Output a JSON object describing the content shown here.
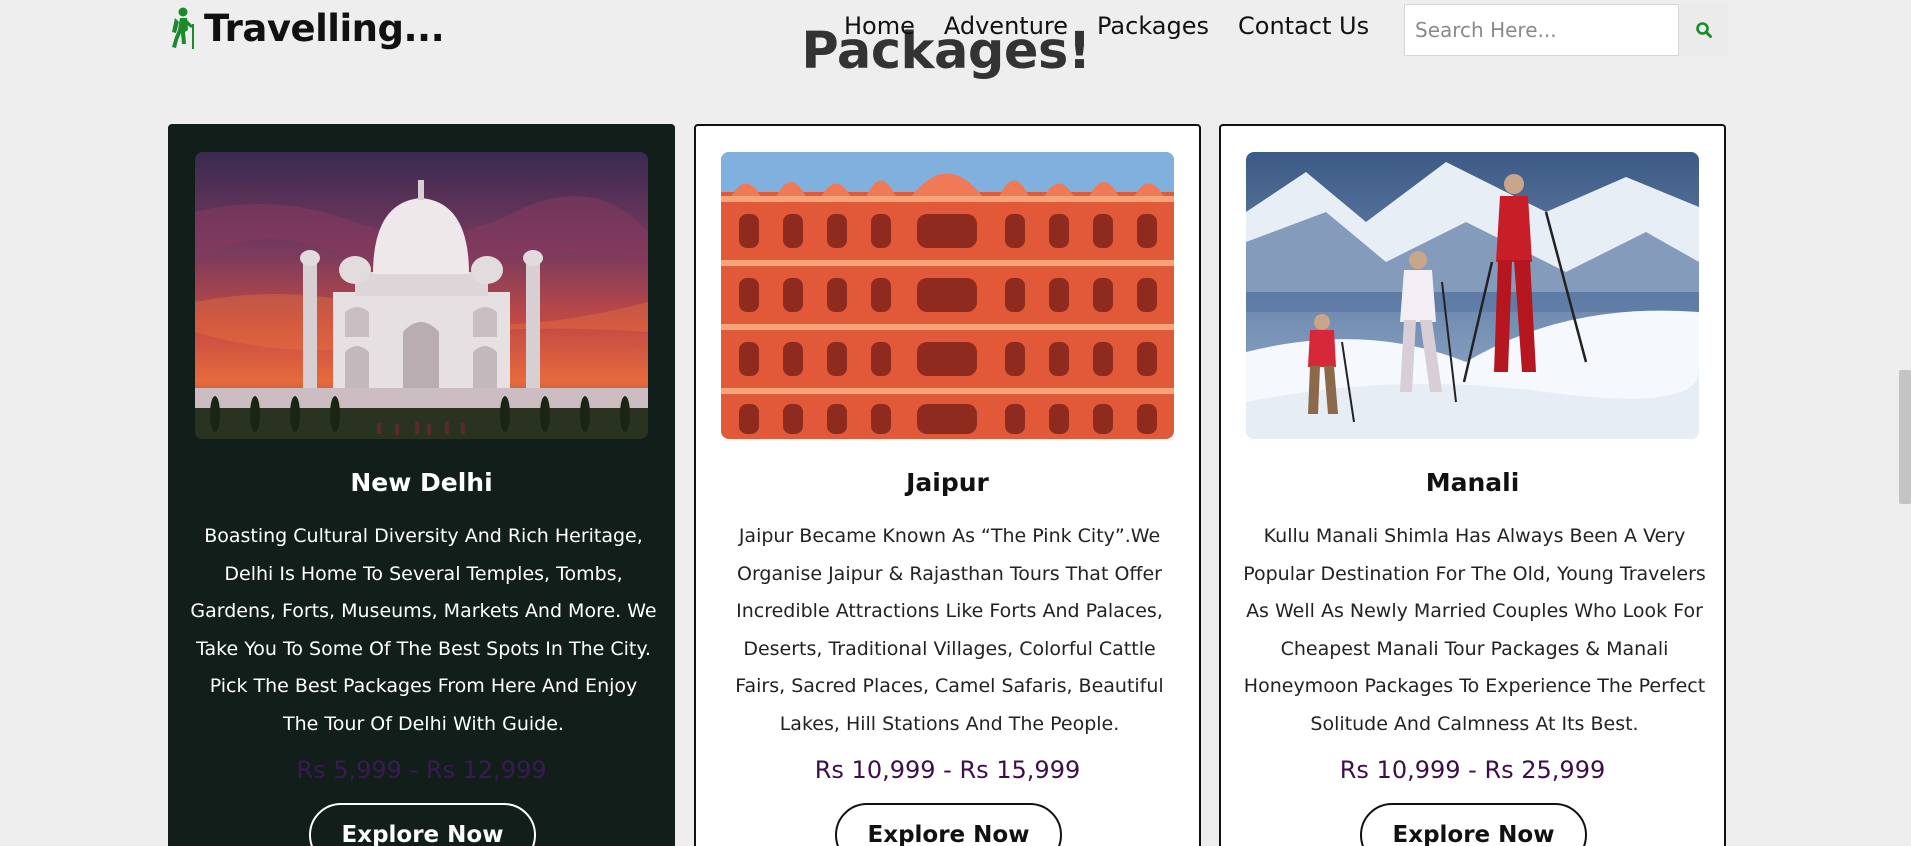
{
  "header": {
    "logo_icon": "hiker-icon",
    "logo_text": "Travelling...",
    "nav": [
      {
        "label": "Home"
      },
      {
        "label": "Adventure"
      },
      {
        "label": "Packages"
      },
      {
        "label": "Contact Us"
      }
    ],
    "search_placeholder": "Search Here...",
    "search_icon": "search-icon"
  },
  "section": {
    "title": "Packages!"
  },
  "packages": [
    {
      "title": "New Delhi",
      "description": "Boasting Cultural Diversity And Rich Heritage, Delhi Is Home To Several Temples, Tombs, Gardens, Forts, Museums, Markets And More. We Take You To Some Of The Best Spots In The City. Pick The Best Packages From Here And Enjoy The Tour Of Delhi With Guide.",
      "price": "Rs 5,999 - Rs 12,999",
      "button": "Explore Now",
      "image": "taj-mahal-photo"
    },
    {
      "title": "Jaipur",
      "description": "Jaipur Became Known As “The Pink City”.We Organise Jaipur & Rajasthan Tours That Offer Incredible Attractions Like Forts And Palaces, Deserts, Traditional Villages, Colorful Cattle Fairs, Sacred Places, Camel Safaris, Beautiful Lakes, Hill Stations And The People.",
      "price": "Rs 10,999 - Rs 15,999",
      "button": "Explore Now",
      "image": "hawa-mahal-photo"
    },
    {
      "title": "Manali",
      "description": "Kullu Manali Shimla Has Always Been A Very Popular Destination For The Old, Young Travelers As Well As Newly Married Couples Who Look For Cheapest Manali Tour Packages & Manali Honeymoon Packages To Experience The Perfect Solitude And Calmness At Its Best.",
      "price": "Rs 10,999 - Rs 25,999",
      "button": "Explore Now",
      "image": "snow-trekking-photo"
    }
  ],
  "colors": {
    "page_bg": "#eeeeee",
    "accent_green": "#1a8a2a",
    "dark_card": "#111e1a",
    "price": "#3d0e4a"
  }
}
